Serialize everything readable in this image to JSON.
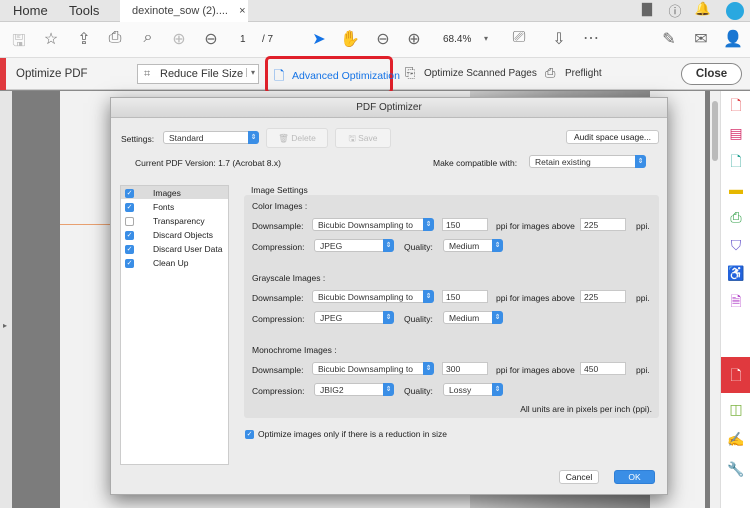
{
  "tabbar": {
    "home": "Home",
    "tools": "Tools",
    "doc_tab": "dexinote_sow (2)....",
    "close": "×"
  },
  "toolbar": {
    "page_current": "1",
    "page_total": "/ 7",
    "zoom": "68.4%"
  },
  "optbar": {
    "title": "Optimize PDF",
    "reduce": "Reduce File Size",
    "advanced": "Advanced Optimization",
    "scanned": "Optimize Scanned Pages",
    "preflight": "Preflight",
    "close": "Close",
    "highlight_color": "#e0202a"
  },
  "dialog": {
    "title": "PDF Optimizer",
    "settings_label": "Settings:",
    "settings_value": "Standard",
    "delete": "Delete",
    "save": "Save",
    "audit": "Audit space usage...",
    "version": "Current PDF Version: 1.7 (Acrobat 8.x)",
    "compat_label": "Make compatible with:",
    "compat_value": "Retain existing",
    "categories": [
      {
        "label": "Images",
        "checked": true
      },
      {
        "label": "Fonts",
        "checked": true
      },
      {
        "label": "Transparency",
        "checked": false
      },
      {
        "label": "Discard Objects",
        "checked": true
      },
      {
        "label": "Discard User Data",
        "checked": true
      },
      {
        "label": "Clean Up",
        "checked": true
      }
    ],
    "section_title": "Image Settings",
    "downsample_label": "Downsample:",
    "compression_label": "Compression:",
    "quality_label": "Quality:",
    "above_label": "ppi for images above",
    "ppi": "ppi.",
    "groups": [
      {
        "title": "Color Images :",
        "method": "Bicubic Downsampling to",
        "ppi": "150",
        "above": "225",
        "compression": "JPEG",
        "quality": "Medium"
      },
      {
        "title": "Grayscale Images :",
        "method": "Bicubic Downsampling to",
        "ppi": "150",
        "above": "225",
        "compression": "JPEG",
        "quality": "Medium"
      },
      {
        "title": "Monochrome Images :",
        "method": "Bicubic Downsampling to",
        "ppi": "300",
        "above": "450",
        "compression": "JBIG2",
        "quality": "Lossy"
      }
    ],
    "units_note": "All units are in pixels per inch (ppi).",
    "optimize_only": "Optimize images only if there is a reduction in size",
    "cancel": "Cancel",
    "ok": "OK"
  }
}
